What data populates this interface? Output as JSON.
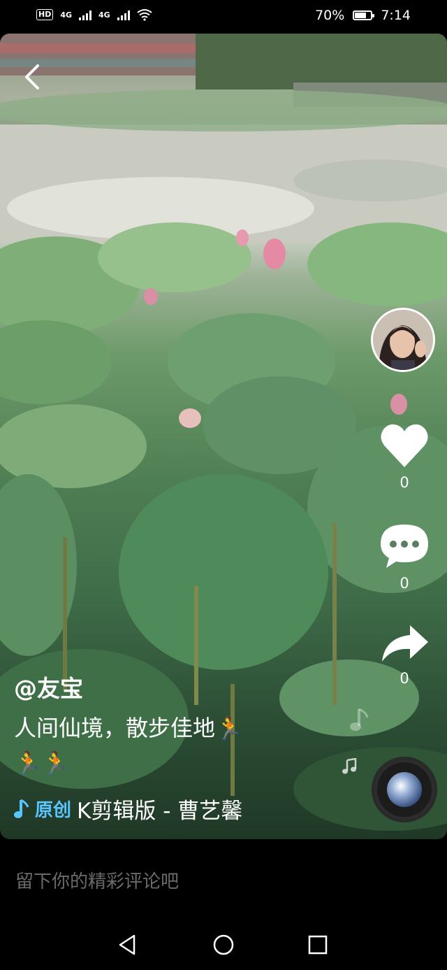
{
  "status_bar": {
    "left_badges": [
      "HD",
      "4G",
      "4G"
    ],
    "battery_text": "70%",
    "battery_level": 0.7,
    "time": "7:14"
  },
  "video": {
    "author": "@友宝",
    "description_line1": "人间仙境，散步佳地🏃",
    "description_line2": "🏃🏃",
    "music_label": "原创",
    "music_title": "K剪辑版 - 曹艺馨"
  },
  "actions": {
    "like_count": "0",
    "comment_count": "0",
    "share_count": "0"
  },
  "comment": {
    "placeholder": "留下你的精彩评论吧"
  },
  "icons": [
    "back-icon",
    "heart-icon",
    "comment-bubble-icon",
    "share-arrow-icon",
    "music-note-icon",
    "music-disc-icon",
    "nav-back-icon",
    "nav-home-icon",
    "nav-recents-icon"
  ]
}
